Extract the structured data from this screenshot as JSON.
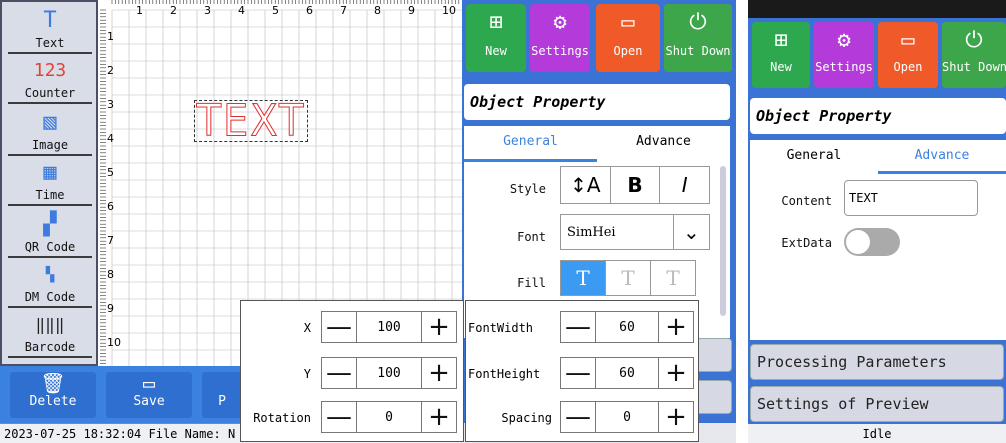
{
  "toolbox": {
    "items": [
      {
        "label": "Text",
        "icon": "text-icon",
        "glyph": "T"
      },
      {
        "label": "Counter",
        "icon": "counter-icon",
        "glyph": "123"
      },
      {
        "label": "Image",
        "icon": "image-icon",
        "glyph": "▧"
      },
      {
        "label": "Time",
        "icon": "calendar-icon",
        "glyph": "▦"
      },
      {
        "label": "QR Code",
        "icon": "qr-code-icon",
        "glyph": "▞"
      },
      {
        "label": "DM Code",
        "icon": "dm-code-icon",
        "glyph": "▚"
      },
      {
        "label": "Barcode",
        "icon": "barcode-icon",
        "glyph": "‖‖‖"
      }
    ]
  },
  "canvas": {
    "ruler_top": [
      "1",
      "2",
      "3",
      "4",
      "5",
      "6",
      "7",
      "8",
      "9",
      "10"
    ],
    "ruler_left": [
      "1",
      "2",
      "3",
      "4",
      "5",
      "6",
      "7",
      "8",
      "9",
      "10"
    ],
    "object_text": "TEXT"
  },
  "bottom": {
    "delete_label": "Delete",
    "save_label": "Save",
    "partial_label": "P"
  },
  "status": {
    "text": "2023-07-25 18:32:04 File Name: N"
  },
  "toolbar": {
    "new": "New",
    "settings": "Settings",
    "open": "Open",
    "shutdown": "Shut Down",
    "colors": {
      "new": "#2ea84f",
      "settings": "#b43ad9",
      "open": "#f05a28",
      "shutdown": "#3da64a"
    }
  },
  "property": {
    "title": "Object Property",
    "tab_general": "General",
    "tab_advance": "Advance",
    "style_label": "Style",
    "font_label": "Font",
    "font_value": "SimHei",
    "fill_label": "Fill"
  },
  "position": {
    "x_label": "X",
    "x_value": "100",
    "y_label": "Y",
    "y_value": "100",
    "rotation_label": "Rotation",
    "rotation_value": "0"
  },
  "fontsize": {
    "width_label": "FontWidth",
    "width_value": "60",
    "height_label": "FontHeight",
    "height_value": "60",
    "spacing_label": "Spacing",
    "spacing_value": "0"
  },
  "right_panel": {
    "title": "Object Property",
    "tab_general": "General",
    "tab_advance": "Advance",
    "content_label": "Content",
    "content_value": "TEXT",
    "extdata_label": "ExtData",
    "processing": "Processing Parameters",
    "preview": "Settings of Preview",
    "state": "Idle"
  }
}
